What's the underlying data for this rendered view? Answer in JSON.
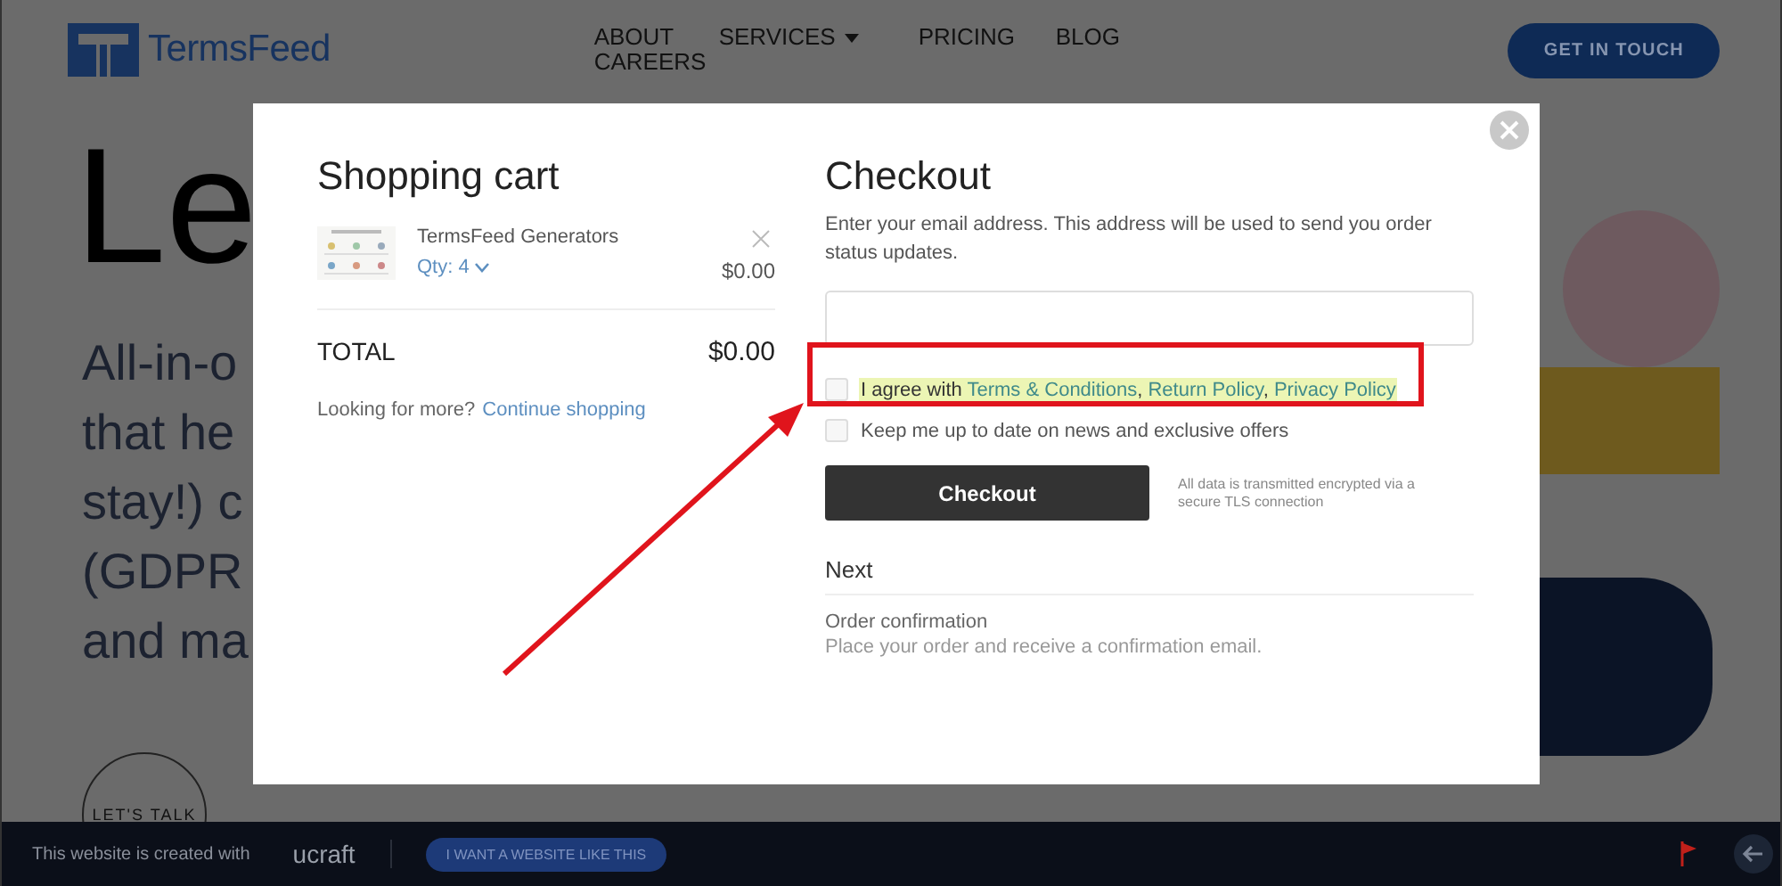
{
  "header": {
    "logo": "TermsFeed",
    "nav": [
      {
        "label": "ABOUT",
        "dropdown": false
      },
      {
        "label": "SERVICES",
        "dropdown": true
      },
      {
        "label": "PRICING",
        "dropdown": false
      },
      {
        "label": "BLOG",
        "dropdown": false
      },
      {
        "label": "CAREERS",
        "dropdown": false
      }
    ],
    "cta": "GET IN TOUCH"
  },
  "hero": {
    "heading": "Le",
    "lines": [
      "All-in-o",
      "that he",
      "stay!) c",
      "(GDPR",
      "and ma"
    ],
    "talk_button": "LET'S TALK"
  },
  "modal": {
    "cart": {
      "title": "Shopping cart",
      "items": [
        {
          "name": "TermsFeed Generators",
          "qty": "Qty: 4",
          "price": "$0.00"
        }
      ],
      "total_label": "TOTAL",
      "total": "$0.00",
      "more_text": "Looking for more?",
      "more_link": "Continue shopping"
    },
    "checkout": {
      "title": "Checkout",
      "intro": "Enter your email address. This address will be used to send you order status updates.",
      "options": [
        {
          "checked": false,
          "highlighted": true,
          "parts": [
            {
              "text": "I agree with ",
              "link": false
            },
            {
              "text": "Terms & Conditions",
              "link": true
            },
            {
              "text": ", ",
              "link": false
            },
            {
              "text": "Return Policy",
              "link": true
            },
            {
              "text": ", ",
              "link": false
            },
            {
              "text": "Privacy Policy",
              "link": true
            }
          ]
        },
        {
          "checked": false,
          "highlighted": false,
          "parts": [
            {
              "text": "Keep me up to date on news and exclusive offers",
              "link": false
            }
          ]
        }
      ],
      "button": "Checkout",
      "secure_note": "All data is transmitted encrypted via a secure TLS connection"
    },
    "next": {
      "title": "Next",
      "step": "Order confirmation",
      "description": "Place your order and receive a confirmation email."
    }
  },
  "bottom_bar": {
    "text": "This website is created with",
    "brand": "ucraft",
    "button": "I WANT A WEBSITE LIKE THIS"
  }
}
